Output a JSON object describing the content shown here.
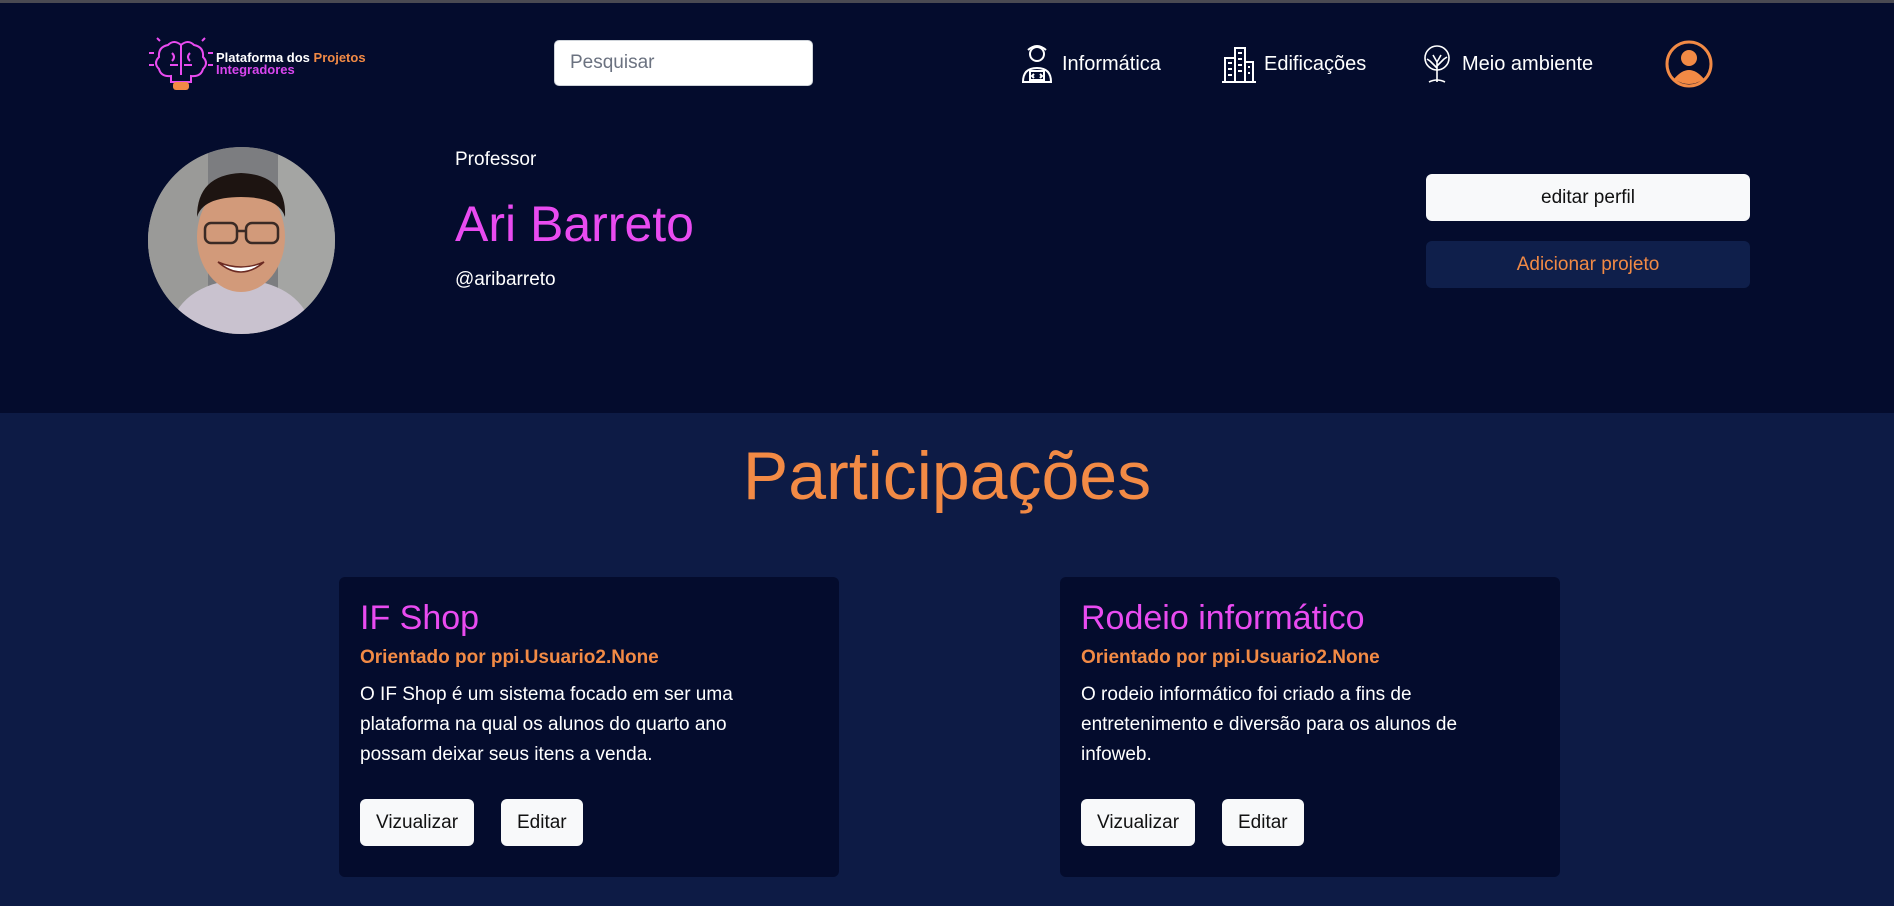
{
  "header": {
    "logo": {
      "text_part1": "Plataforma dos",
      "text_part2": "Projetos",
      "text_part3": "Integradores",
      "icon": "brain-lightbulb-icon"
    },
    "search": {
      "placeholder": "Pesquisar",
      "value": ""
    },
    "nav": [
      {
        "label": "Informática",
        "icon": "developer-icon"
      },
      {
        "label": "Edificações",
        "icon": "buildings-icon"
      },
      {
        "label": "Meio ambiente",
        "icon": "tree-icon"
      }
    ],
    "account_icon": "user-circle-icon"
  },
  "profile": {
    "role": "Professor",
    "name": "Ari Barreto",
    "username": "@aribarreto",
    "edit_profile_label": "editar perfil",
    "add_project_label": "Adicionar projeto"
  },
  "participations": {
    "title": "Participações",
    "projects": [
      {
        "title": "IF Shop",
        "advisor": "Orientado por ppi.Usuario2.None",
        "description": "O IF Shop é um sistema focado em ser uma plataforma na qual os alunos do quarto ano possam deixar seus itens a venda.",
        "view_label": "Vizualizar",
        "edit_label": "Editar"
      },
      {
        "title": "Rodeio informático",
        "advisor": "Orientado por ppi.Usuario2.None",
        "description": "O rodeio informático foi criado a fins de entretenimento e diversão para os alunos de infoweb.",
        "view_label": "Vizualizar",
        "edit_label": "Editar"
      }
    ]
  },
  "colors": {
    "header_bg": "#040c2d",
    "body_bg": "#0d1b45",
    "accent_orange": "#f28a45",
    "accent_pink": "#e94bf0"
  }
}
